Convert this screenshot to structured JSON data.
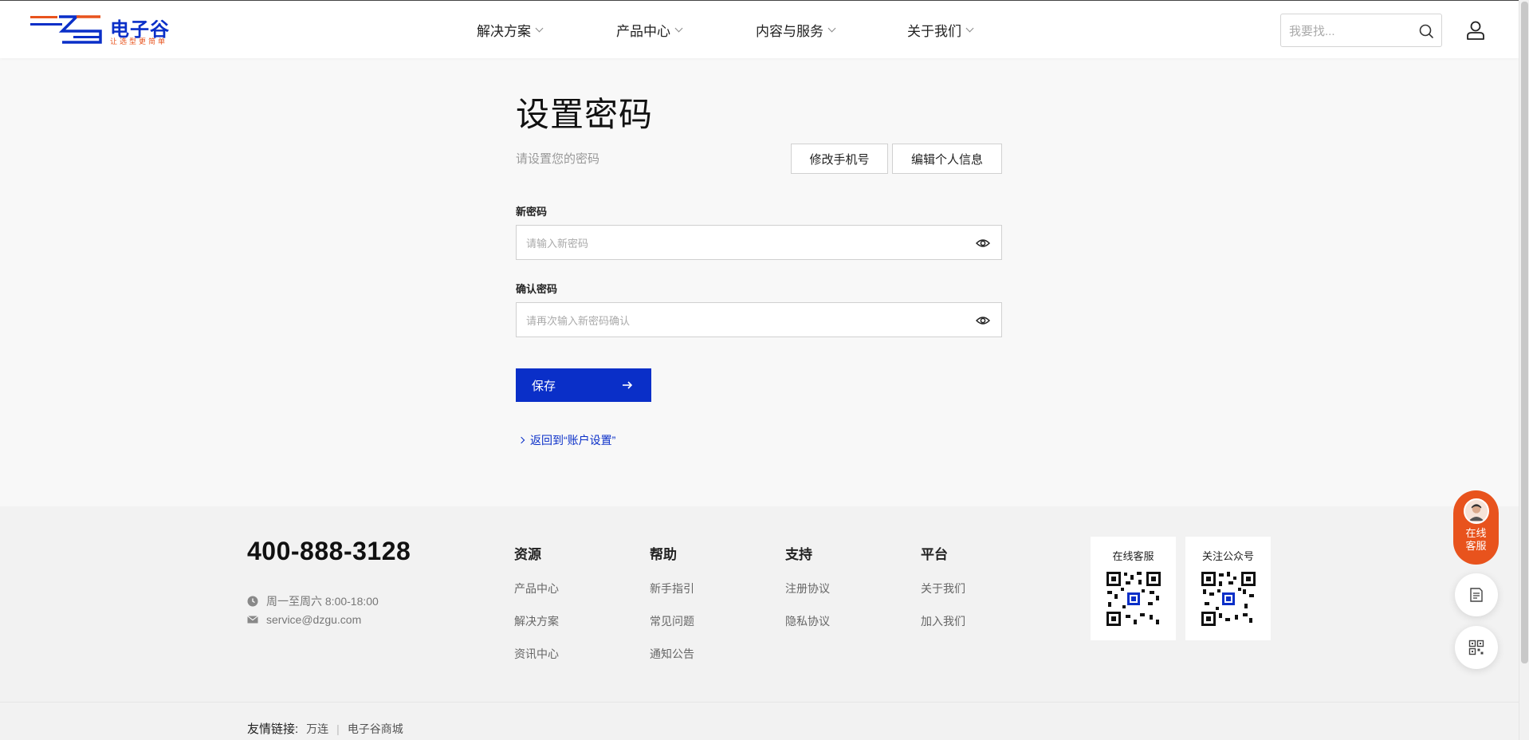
{
  "brand": {
    "name": "电子谷",
    "slogan": "让选型更简单"
  },
  "nav": [
    {
      "label": "解决方案"
    },
    {
      "label": "产品中心"
    },
    {
      "label": "内容与服务"
    },
    {
      "label": "关于我们"
    }
  ],
  "search": {
    "placeholder": "我要找..."
  },
  "page": {
    "title": "设置密码",
    "subtitle": "请设置您的密码",
    "btn_change_phone": "修改手机号",
    "btn_edit_profile": "编辑个人信息",
    "new_password_label": "新密码",
    "new_password_placeholder": "请输入新密码",
    "confirm_password_label": "确认密码",
    "confirm_password_placeholder": "请再次输入新密码确认",
    "save_label": "保存",
    "back_link": "返回到“账户设置”"
  },
  "footer": {
    "phone": "400-888-3128",
    "hours": "周一至周六 8:00-18:00",
    "email": "service@dzgu.com",
    "columns": [
      {
        "title": "资源",
        "links": [
          "产品中心",
          "解决方案",
          "资讯中心"
        ]
      },
      {
        "title": "帮助",
        "links": [
          "新手指引",
          "常见问题",
          "通知公告"
        ]
      },
      {
        "title": "支持",
        "links": [
          "注册协议",
          "隐私协议"
        ]
      },
      {
        "title": "平台",
        "links": [
          "关于我们",
          "加入我们"
        ]
      }
    ],
    "qr": [
      {
        "title": "在线客服"
      },
      {
        "title": "关注公众号"
      }
    ],
    "friend_links_label": "友情链接:",
    "friend_links": [
      "万连",
      "电子谷商城"
    ]
  },
  "float": {
    "cs_line1": "在线",
    "cs_line2": "客服"
  },
  "colors": {
    "brand_blue": "#0a2fc8",
    "brand_orange": "#e8531d"
  }
}
